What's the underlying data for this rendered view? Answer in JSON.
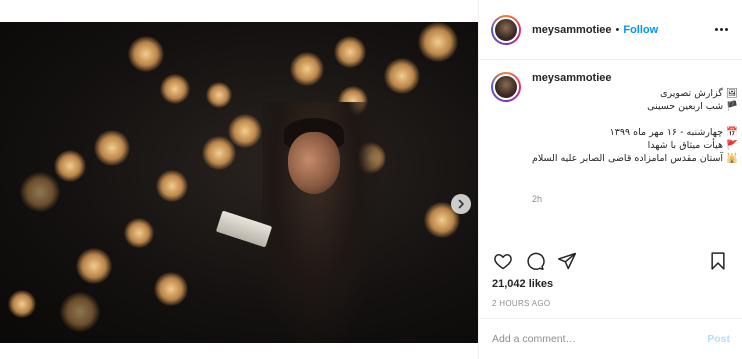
{
  "post": {
    "username": "meysammotiee",
    "bullet": "•",
    "follow_label": "Follow",
    "caption_lines": [
      "🖼 گزارش تصویری",
      "🏴 شب اربعین حسینی",
      "",
      "📅 چهارشنبه - ۱۶ مهر ماه ۱۳۹۹",
      "🚩 هیأت میثاق با شهدا",
      "🕌 آستان مقدس امامزاده قاضی الصابر علیه السلام"
    ],
    "caption_time": "2h",
    "likes": "21,042 likes",
    "posted_ago": "2 HOURS AGO",
    "comment_placeholder": "Add a comment…",
    "post_label": "Post"
  },
  "carousel": {
    "slide_count": 5,
    "active_index": 0
  },
  "colors": {
    "accent": "#0095f6",
    "text": "#262626",
    "muted": "#8e8e8e",
    "post_disabled": "#b2dffc"
  }
}
